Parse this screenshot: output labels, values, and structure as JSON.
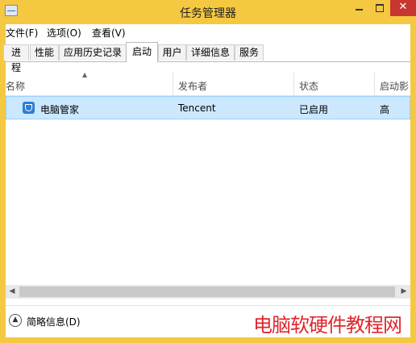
{
  "window": {
    "title": "任务管理器"
  },
  "menu": {
    "items": [
      "文件(F)",
      "选项(O)",
      "查看(V)"
    ]
  },
  "tabs": [
    "进程",
    "性能",
    "应用历史记录",
    "启动",
    "用户",
    "详细信息",
    "服务"
  ],
  "active_tab": "启动",
  "columns": [
    "名称",
    "发布者",
    "状态",
    "启动影"
  ],
  "rows": [
    {
      "name": "电脑管家",
      "publisher": "Tencent",
      "status": "已启用",
      "impact": "高"
    }
  ],
  "footer": {
    "fewer_details": "简略信息(D)"
  },
  "watermark": "电脑软硬件教程网",
  "colors": {
    "window_frame": "#f5c842",
    "selection": "#cce8ff",
    "close": "#c7372f",
    "watermark": "#e0262a"
  }
}
